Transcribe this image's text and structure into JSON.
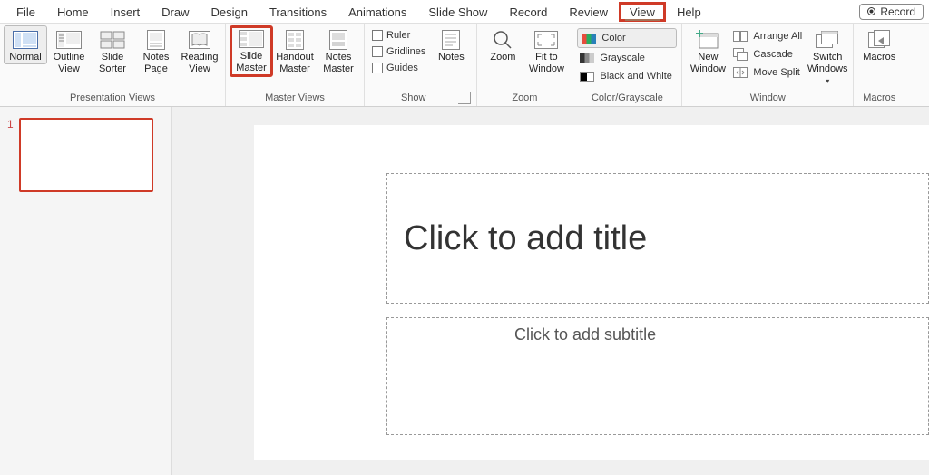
{
  "tabs": {
    "file": "File",
    "home": "Home",
    "insert": "Insert",
    "draw": "Draw",
    "design": "Design",
    "transitions": "Transitions",
    "animations": "Animations",
    "slideshow": "Slide Show",
    "record": "Record",
    "review": "Review",
    "view": "View",
    "help": "Help"
  },
  "record_btn": "Record",
  "ribbon": {
    "presentation_views": {
      "label": "Presentation Views",
      "normal": "Normal",
      "outline": "Outline\nView",
      "sorter": "Slide\nSorter",
      "notes": "Notes\nPage",
      "reading": "Reading\nView"
    },
    "master_views": {
      "label": "Master Views",
      "slide": "Slide\nMaster",
      "handout": "Handout\nMaster",
      "notes": "Notes\nMaster"
    },
    "show": {
      "label": "Show",
      "ruler": "Ruler",
      "gridlines": "Gridlines",
      "guides": "Guides",
      "notes": "Notes"
    },
    "zoom": {
      "label": "Zoom",
      "zoom": "Zoom",
      "fit": "Fit to\nWindow"
    },
    "color": {
      "label": "Color/Grayscale",
      "color": "Color",
      "grayscale": "Grayscale",
      "bw": "Black and White"
    },
    "window": {
      "label": "Window",
      "new": "New\nWindow",
      "arrange": "Arrange All",
      "cascade": "Cascade",
      "split": "Move Split",
      "switch": "Switch\nWindows"
    },
    "macros": {
      "label": "Macros",
      "macros": "Macros"
    }
  },
  "canvas": {
    "slide_number": "1",
    "title_placeholder": "Click to add title",
    "subtitle_placeholder": "Click to add subtitle"
  }
}
